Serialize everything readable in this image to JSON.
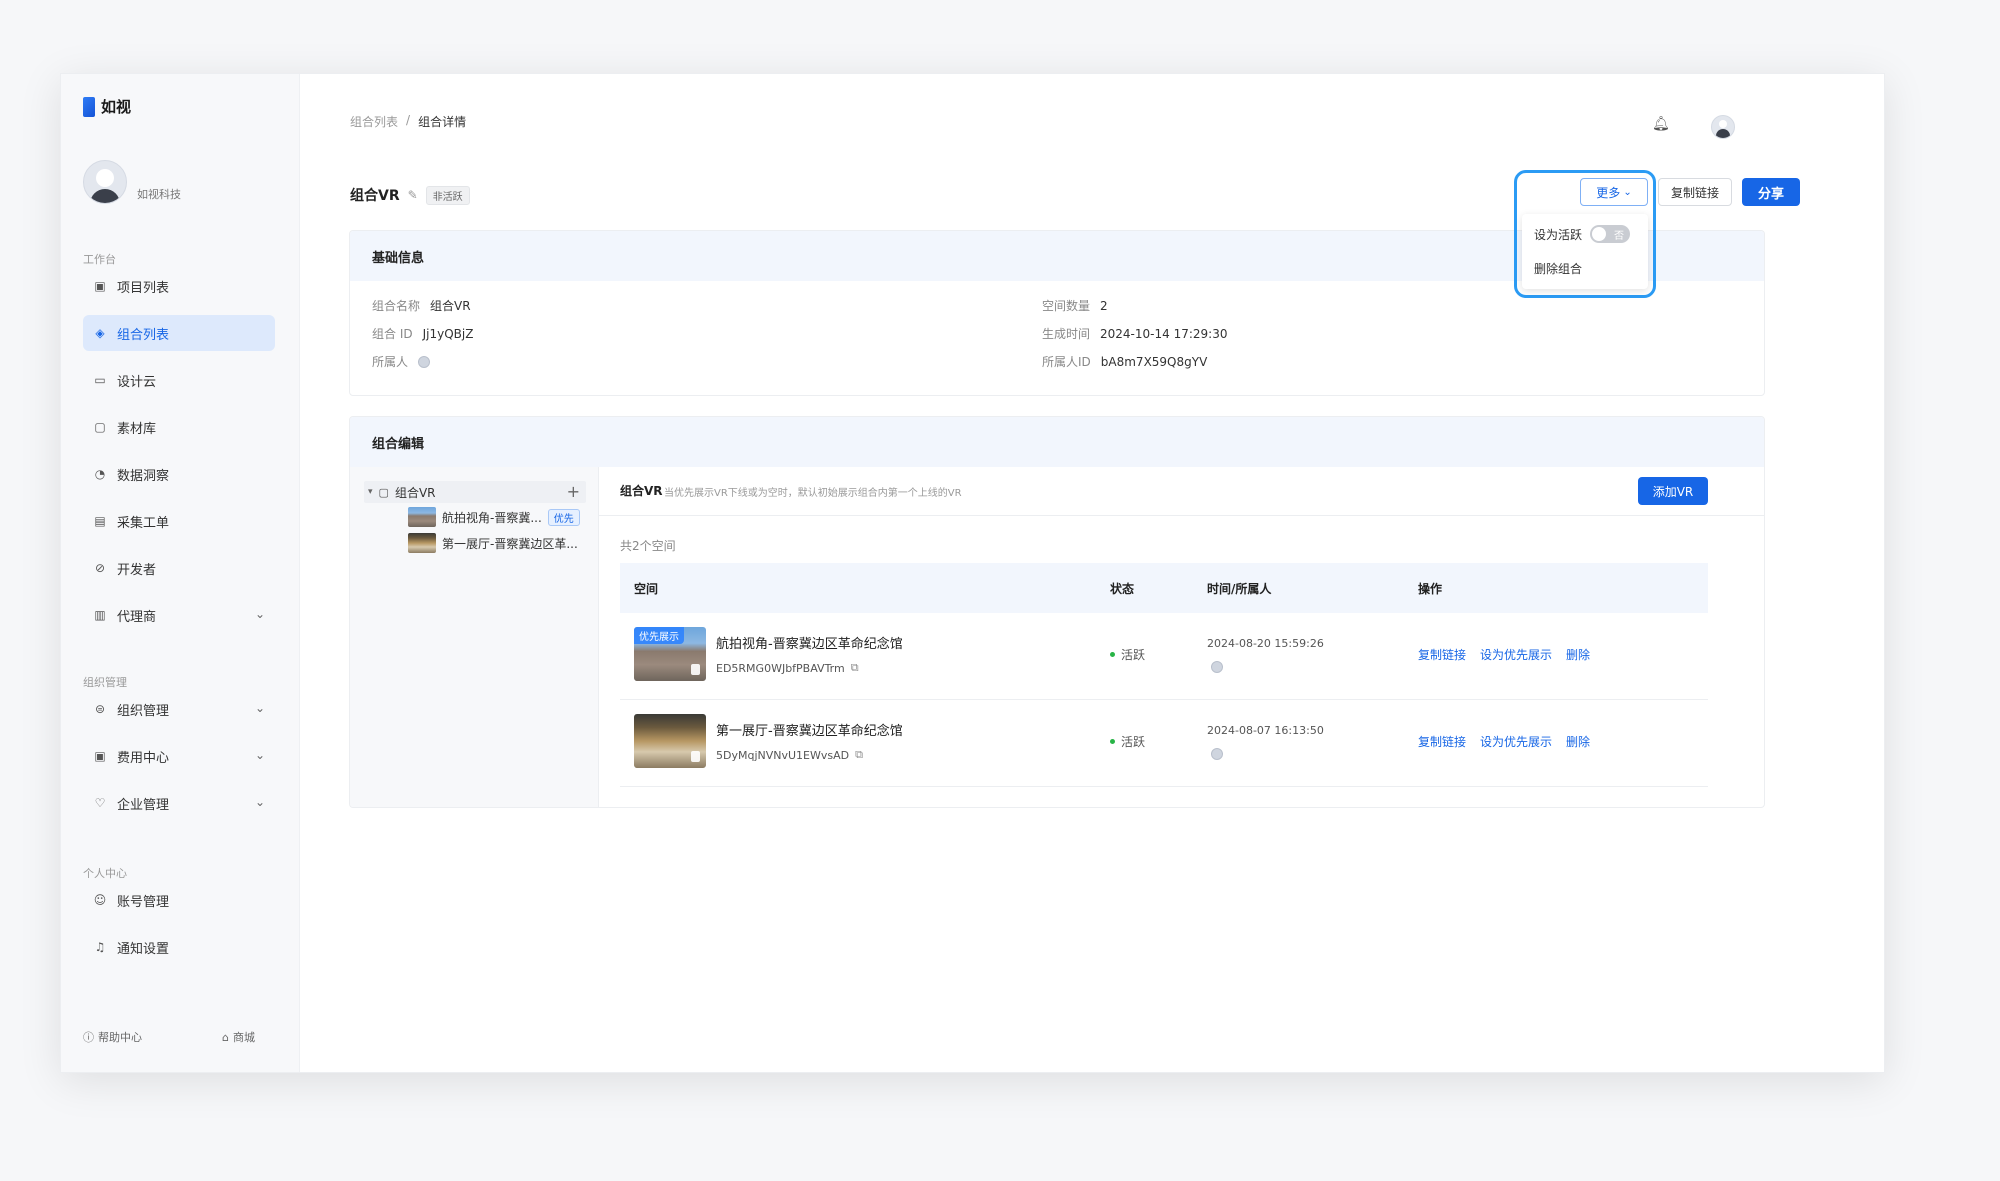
{
  "app": {
    "name": "如视"
  },
  "user": {
    "name": "如视科技"
  },
  "sidebar": {
    "sections": {
      "workbench": "工作台",
      "org": "组织管理",
      "personal": "个人中心"
    },
    "items": [
      {
        "label": "项目列表",
        "icon": "vr-icon"
      },
      {
        "label": "组合列表",
        "icon": "layers-icon",
        "active": true
      },
      {
        "label": "设计云",
        "icon": "monitor-icon"
      },
      {
        "label": "素材库",
        "icon": "folder-icon"
      },
      {
        "label": "数据洞察",
        "icon": "pie-chart-icon"
      },
      {
        "label": "采集工单",
        "icon": "document-icon"
      },
      {
        "label": "开发者",
        "icon": "code-icon"
      },
      {
        "label": "代理商",
        "icon": "briefcase-icon"
      },
      {
        "label": "组织管理",
        "icon": "org-icon"
      },
      {
        "label": "费用中心",
        "icon": "wallet-icon"
      },
      {
        "label": "企业管理",
        "icon": "shield-icon"
      },
      {
        "label": "账号管理",
        "icon": "user-icon"
      },
      {
        "label": "通知设置",
        "icon": "bell-icon"
      }
    ],
    "footer": {
      "help": "帮助中心",
      "store": "商城"
    }
  },
  "breadcrumb": {
    "parent": "组合列表",
    "sep": "/",
    "current": "组合详情"
  },
  "header": {
    "title": "组合VR",
    "status_tag": "非活跃",
    "more_label": "更多",
    "copy_link_label": "复制链接",
    "share_label": "分享"
  },
  "dropdown": {
    "set_active_label": "设为活跃",
    "toggle_text": "否",
    "delete_label": "删除组合"
  },
  "basic_info": {
    "heading": "基础信息",
    "fields": [
      {
        "label": "组合名称",
        "value": "组合VR"
      },
      {
        "label": "组合 ID",
        "value": "Jj1yQBjZ"
      },
      {
        "label": "所属人",
        "value": ""
      },
      {
        "label": "空间数量",
        "value": "2"
      },
      {
        "label": "生成时间",
        "value": "2024-10-14 17:29:30"
      },
      {
        "label": "所属人ID",
        "value": "bA8m7X59Q8gYV"
      }
    ]
  },
  "edit": {
    "heading": "组合编辑",
    "tree": {
      "root": "组合VR",
      "children": [
        {
          "label": "航拍视角-晋察冀...",
          "tag": "优先"
        },
        {
          "label": "第一展厅-晋察冀边区革..."
        }
      ]
    },
    "panel_title": "组合VR",
    "panel_hint": "当优先展示VR下线或为空时，默认初始展示组合内第一个上线的VR",
    "add_label": "添加VR",
    "count_label": "共2个空间",
    "columns": [
      "空间",
      "状态",
      "时间/所属人",
      "操作"
    ],
    "rows": [
      {
        "badge": "优先展示",
        "name": "航拍视角-晋察冀边区革命纪念馆",
        "id": "ED5RMG0WJbfPBAVTrm",
        "status": "活跃",
        "time": "2024-08-20 15:59:26",
        "actions": [
          "复制链接",
          "设为优先展示",
          "删除"
        ]
      },
      {
        "badge": "",
        "name": "第一展厅-晋察冀边区革命纪念馆",
        "id": "5DyMqjNVNvU1EWvsAD",
        "status": "活跃",
        "time": "2024-08-07 16:13:50",
        "actions": [
          "复制链接",
          "设为优先展示",
          "删除"
        ]
      }
    ]
  },
  "colors": {
    "primary": "#1766e6",
    "active_bg": "#dde9fc",
    "highlight": "#2b9bf4"
  }
}
